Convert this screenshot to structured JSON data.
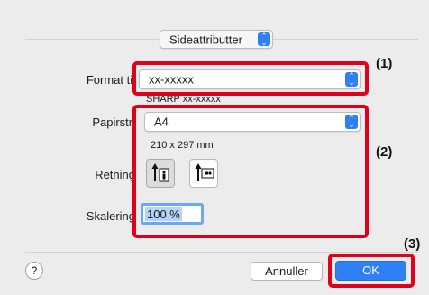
{
  "section_popup": {
    "label": "Sideattributter"
  },
  "format_for": {
    "label": "Format til",
    "value": "xx-xxxxx",
    "subtitle": "SHARP xx-xxxxx"
  },
  "paper_size": {
    "label": "Papirstr.",
    "value": "A4",
    "dimensions": "210 x 297 mm"
  },
  "orientation": {
    "label": "Retning",
    "selected": "portrait"
  },
  "scale": {
    "label": "Skalering",
    "value": "100 %"
  },
  "callouts": {
    "one": "(1)",
    "two": "(2)",
    "three": "(3)"
  },
  "buttons": {
    "help": "?",
    "cancel": "Annuller",
    "ok": "OK"
  },
  "colors": {
    "highlight_box": "#e0001b",
    "accent": "#2f7ff5"
  }
}
